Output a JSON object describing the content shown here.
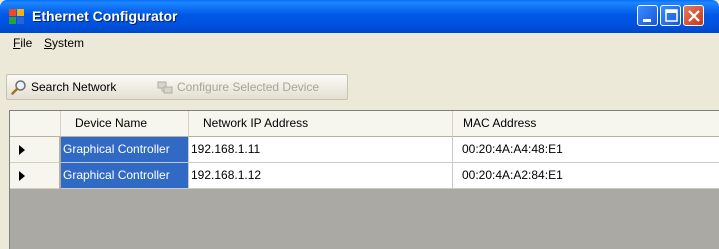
{
  "window": {
    "title": "Ethernet Configurator",
    "icon": "app-grid-icon",
    "controls": [
      "minimize-icon",
      "maximize-icon",
      "close-icon"
    ]
  },
  "menu": {
    "file_prefix": "F",
    "file_rest": "ile",
    "system_prefix": "S",
    "system_rest": "ystem"
  },
  "toolbar": {
    "search_label": "Search Network",
    "search_icon": "magnifier-icon",
    "configure_label": "Configure Selected Device",
    "configure_icon": "network-config-icon",
    "configure_enabled": false
  },
  "grid": {
    "columns": [
      "Device Name",
      "Network IP Address",
      "MAC Address"
    ],
    "rows": [
      {
        "device_name": "Graphical Controller",
        "ip": "192.168.1.11",
        "mac": "00:20:4A:A4:48:E1"
      },
      {
        "device_name": "Graphical Controller",
        "ip": "192.168.1.12",
        "mac": "00:20:4A:A2:84:E1"
      }
    ]
  },
  "colors": {
    "titlebar": "#0058e6",
    "selection": "#316ac5",
    "grid_background": "#aaa9a4"
  }
}
